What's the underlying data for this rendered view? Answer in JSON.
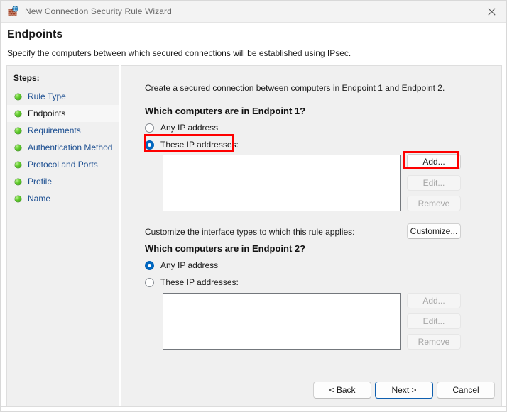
{
  "window": {
    "title": "New Connection Security Rule Wizard",
    "icon": "firewall-globe-icon",
    "close_label": "×"
  },
  "header": {
    "title": "Endpoints",
    "subtitle": "Specify the computers between which secured connections will be established using IPsec."
  },
  "sidebar": {
    "title": "Steps:",
    "items": [
      {
        "label": "Rule Type",
        "current": false
      },
      {
        "label": "Endpoints",
        "current": true
      },
      {
        "label": "Requirements",
        "current": false
      },
      {
        "label": "Authentication Method",
        "current": false
      },
      {
        "label": "Protocol and Ports",
        "current": false
      },
      {
        "label": "Profile",
        "current": false
      },
      {
        "label": "Name",
        "current": false
      }
    ]
  },
  "main": {
    "intro": "Create a secured connection between computers in Endpoint 1 and Endpoint 2.",
    "endpoint1": {
      "question": "Which computers are in Endpoint 1?",
      "radio_any": "Any IP address",
      "radio_these": "These IP addresses:",
      "selected": "these",
      "list_values": [],
      "add_label": "Add...",
      "edit_label": "Edit...",
      "remove_label": "Remove"
    },
    "customize": {
      "label": "Customize the interface types to which this rule applies:",
      "button_label": "Customize..."
    },
    "endpoint2": {
      "question": "Which computers are in Endpoint 2?",
      "radio_any": "Any IP address",
      "radio_these": "These IP addresses:",
      "selected": "any",
      "list_values": [],
      "add_label": "Add...",
      "edit_label": "Edit...",
      "remove_label": "Remove"
    }
  },
  "footer": {
    "back_label": "< Back",
    "next_label": "Next >",
    "cancel_label": "Cancel"
  },
  "annotations": {
    "highlight_color": "#fe0000",
    "targets": [
      "endpoint1-these-ip-radio",
      "endpoint1-add-button"
    ]
  }
}
